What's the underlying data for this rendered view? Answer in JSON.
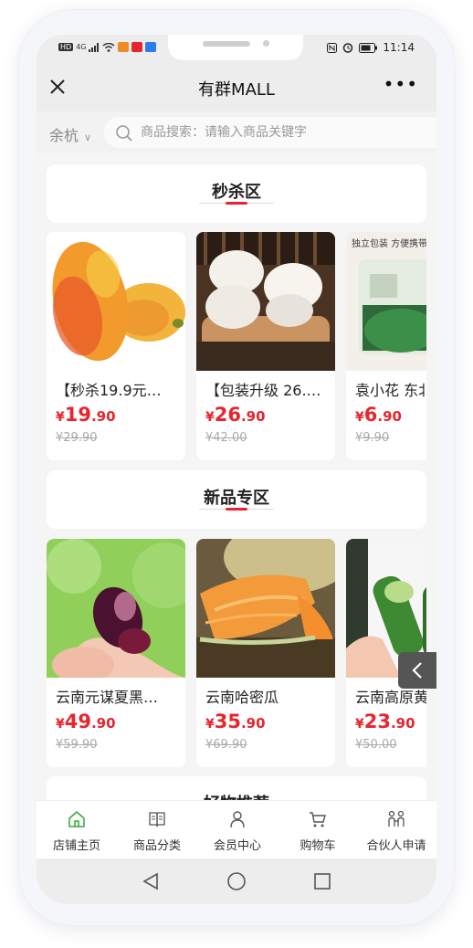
{
  "status": {
    "time": "11:14",
    "left_labels": [
      "HD",
      "4G"
    ]
  },
  "header": {
    "title": "有群MALL",
    "more": "•••"
  },
  "search": {
    "city": "余杭",
    "placeholder": "商品搜索：请输入商品关键字"
  },
  "sections": [
    {
      "title": "秒杀区",
      "products": [
        {
          "name": "【秒杀19.9元…",
          "currency": "¥",
          "price_int": "19",
          "price_dec": ".90",
          "old_price": "¥29.90"
        },
        {
          "name": "【包装升级 26.…",
          "currency": "¥",
          "price_int": "26",
          "price_dec": ".90",
          "old_price": "¥42.00"
        },
        {
          "name": "袁小花 东北",
          "currency": "¥",
          "price_int": "6",
          "price_dec": ".90",
          "old_price": "¥9.90",
          "img_text": "独立包装 方便携带"
        }
      ]
    },
    {
      "title": "新品专区",
      "products": [
        {
          "name": "云南元谋夏黑…",
          "currency": "¥",
          "price_int": "49",
          "price_dec": ".90",
          "old_price": "¥59.90"
        },
        {
          "name": "云南哈密瓜",
          "currency": "¥",
          "price_int": "35",
          "price_dec": ".90",
          "old_price": "¥69.90"
        },
        {
          "name": "云南高原黄瓜",
          "currency": "¥",
          "price_int": "23",
          "price_dec": ".90",
          "old_price": "¥50.00"
        }
      ]
    },
    {
      "title": "好物推荐"
    }
  ],
  "tabbar": [
    {
      "label": "店铺主页",
      "icon": "home-icon"
    },
    {
      "label": "商品分类",
      "icon": "book-icon"
    },
    {
      "label": "会员中心",
      "icon": "user-icon"
    },
    {
      "label": "购物车",
      "icon": "cart-icon"
    },
    {
      "label": "合伙人申请",
      "icon": "partners-icon"
    }
  ],
  "colors": {
    "accent": "#e8252e",
    "active_tab": "#3aa53a",
    "price": "#e8252e"
  }
}
